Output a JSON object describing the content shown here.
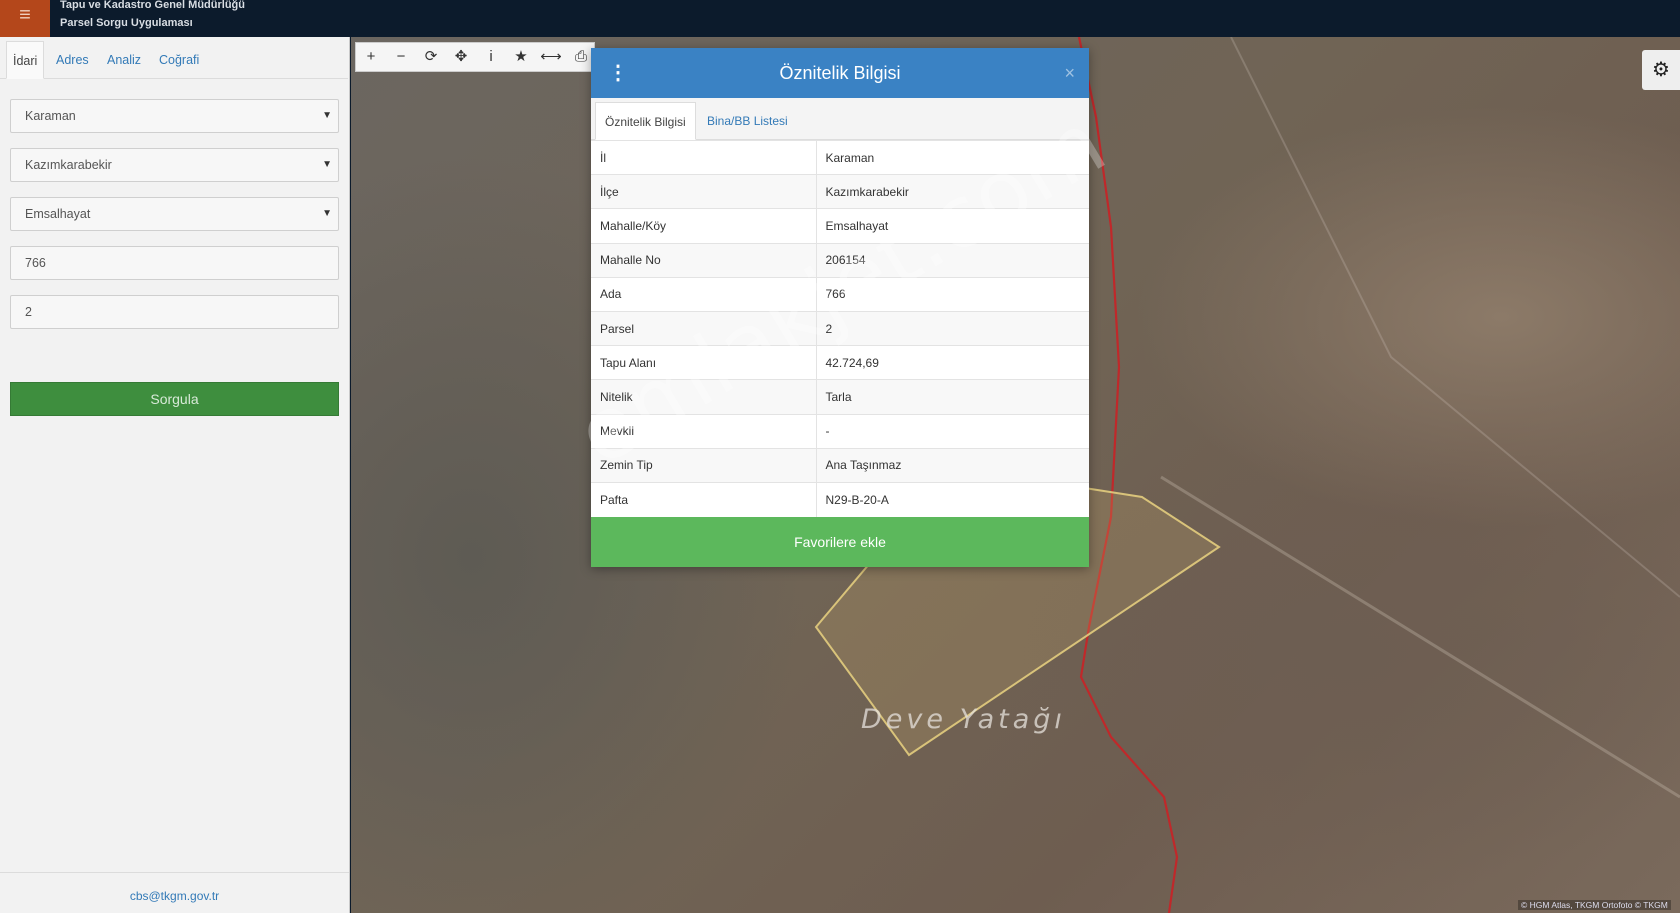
{
  "app": {
    "title_line1": "Tapu ve Kadastro Genel Müdürlüğü",
    "title_line2": "Parsel Sorgu Uygulaması",
    "menu_icon": "≡"
  },
  "sidebar": {
    "tabs": [
      {
        "label": "İdari",
        "active": true
      },
      {
        "label": "Adres",
        "active": false
      },
      {
        "label": "Analiz",
        "active": false
      },
      {
        "label": "Coğrafi",
        "active": false
      }
    ],
    "il": "Karaman",
    "ilce": "Kazımkarabekir",
    "mahalle": "Emsalhayat",
    "ada": "766",
    "parsel": "2",
    "query_button": "Sorgula",
    "footer_email": "cbs@tkgm.gov.tr"
  },
  "map": {
    "toolbar_icons": [
      "plus-icon",
      "minus-icon",
      "refresh-icon",
      "crosshair-icon",
      "info-icon",
      "star-icon",
      "measure-icon",
      "print-icon"
    ],
    "toolbar_glyphs": [
      "+",
      "−",
      "⟳",
      "✥",
      "i",
      "★",
      "⟷",
      "⎙"
    ],
    "settings_glyph": "⚙",
    "place_label": "Deve Yatağı",
    "attribution": "© HGM Atlas, TKGM Ortofoto © TKGM"
  },
  "modal": {
    "title": "Öznitelik Bilgisi",
    "close_glyph": "×",
    "menu_glyph": "⋮",
    "tabs": [
      {
        "label": "Öznitelik Bilgisi",
        "active": true
      },
      {
        "label": "Bina/BB Listesi",
        "active": false
      }
    ],
    "rows": [
      {
        "key": "İl",
        "value": "Karaman"
      },
      {
        "key": "İlçe",
        "value": "Kazımkarabekir"
      },
      {
        "key": "Mahalle/Köy",
        "value": "Emsalhayat"
      },
      {
        "key": "Mahalle No",
        "value": "206154"
      },
      {
        "key": "Ada",
        "value": "766"
      },
      {
        "key": "Parsel",
        "value": "2"
      },
      {
        "key": "Tapu Alanı",
        "value": "42.724,69"
      },
      {
        "key": "Nitelik",
        "value": "Tarla"
      },
      {
        "key": "Mevkii",
        "value": "-"
      },
      {
        "key": "Zemin Tip",
        "value": "Ana Taşınmaz"
      },
      {
        "key": "Pafta",
        "value": "N29-B-20-A"
      }
    ],
    "favorite_button": "Favorilere ekle"
  },
  "watermark": "emlakjet.com",
  "colors": {
    "header_bg": "#0c1b2c",
    "menu_btn": "#b4471b",
    "modal_header": "#3a82c4",
    "favorite_btn": "#5cb85c",
    "query_btn": "#3e8e3e",
    "boundary_red": "#c0282a",
    "parcel_outline": "#d9c37a"
  }
}
